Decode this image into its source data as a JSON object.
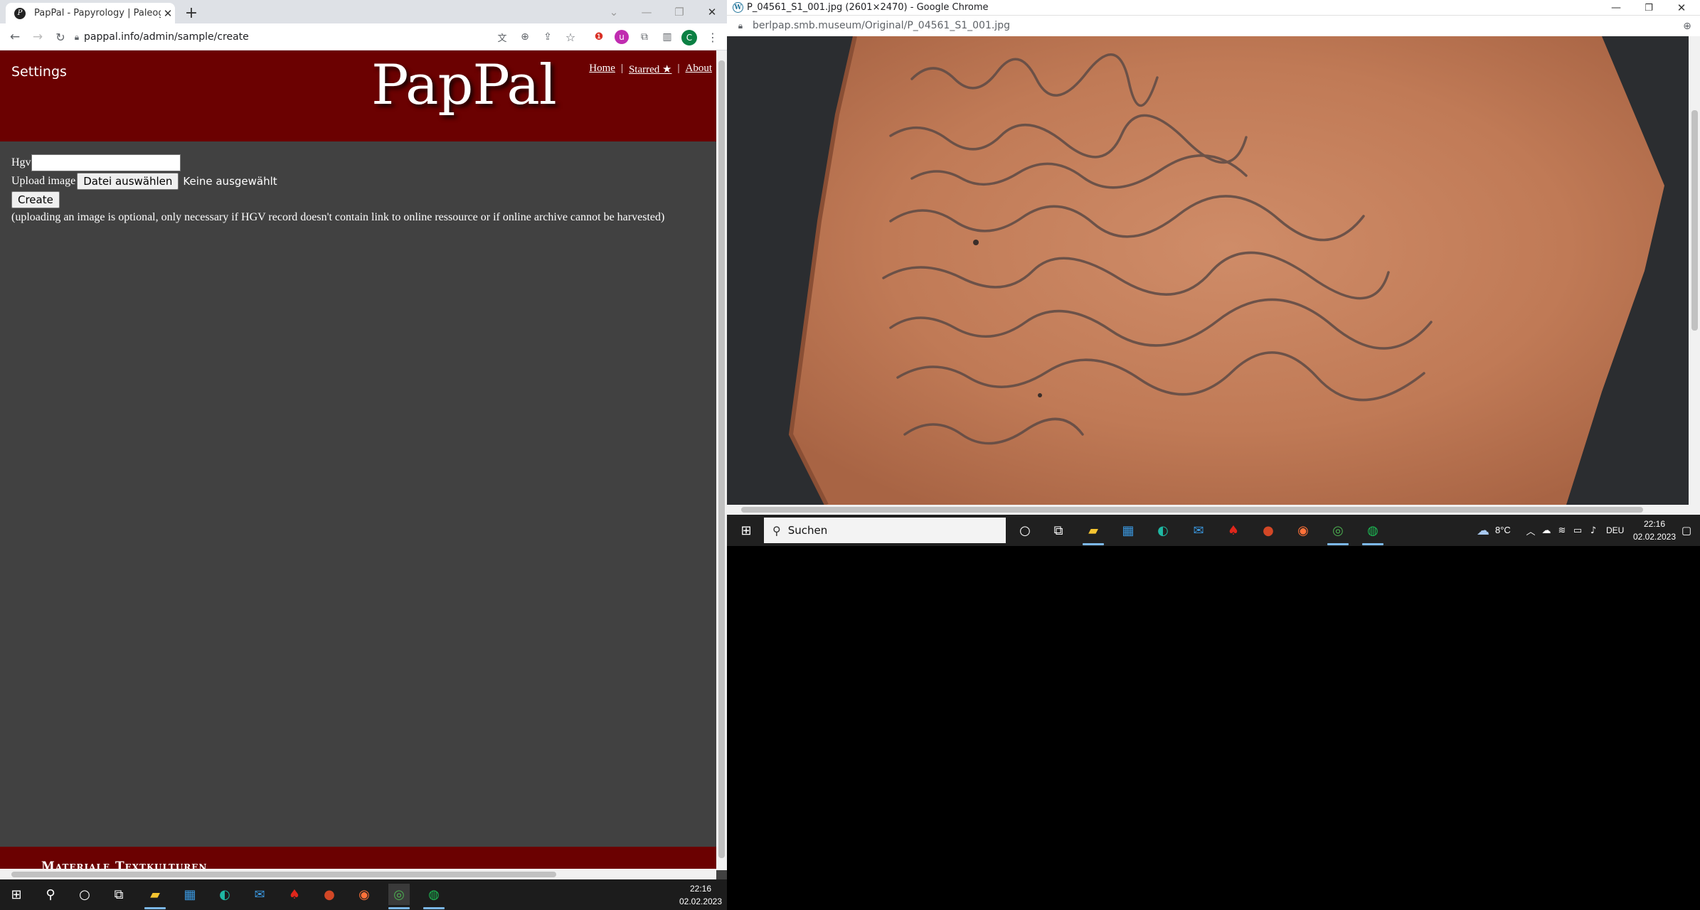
{
  "left_window": {
    "tab_title": "PapPal - Papyrology | Paleography",
    "tab_favicon": "pappal-favicon",
    "url": "pappal.info/admin/sample/create",
    "page": {
      "settings_label": "Settings",
      "logo_text": "PapPal",
      "nav": {
        "home": "Home",
        "sep1": "|",
        "starred": "Starred ★",
        "sep2": "|",
        "about": "About"
      },
      "form": {
        "hgv_label": "Hgv",
        "hgv_value": "",
        "upload_label": "Upload image",
        "choose_file_button": "Datei auswählen",
        "no_file_text": "Keine ausgewählt",
        "create_button": "Create",
        "note": "(uploading an image is optional, only necessary if HGV record doesn't contain link to online ressource or if online archive cannot be harvested)"
      },
      "footer_text": "Materiale Textkulturen"
    },
    "colors": {
      "brand": "#6b0101",
      "page_bg": "#414141"
    }
  },
  "right_window": {
    "window_title": "P_04561_S1_001.jpg (2601×2470) - Google Chrome",
    "url": "berlpap.smb.museum/Original/P_04561_S1_001.jpg",
    "image_description_icon": "ostracon-image"
  },
  "taskbar_left": {
    "time": "22:16",
    "date": "02.02.2023"
  },
  "taskbar_right": {
    "search_placeholder": "Suchen",
    "weather": "8°C",
    "language": "DEU",
    "time": "22:16",
    "date": "02.02.2023"
  }
}
